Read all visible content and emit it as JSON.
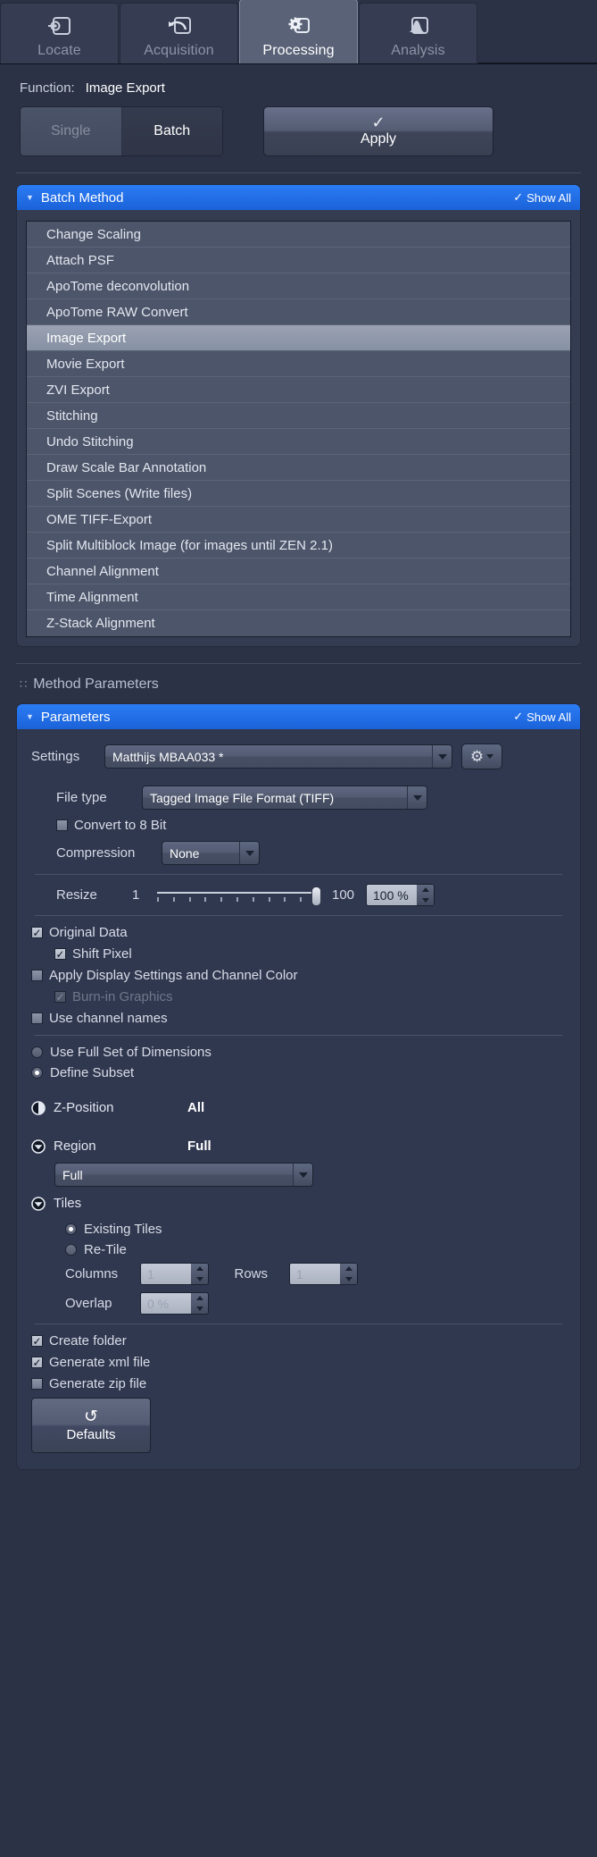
{
  "tabs": [
    {
      "label": "Locate",
      "icon": "locate-icon",
      "active": false
    },
    {
      "label": "Acquisition",
      "icon": "acquisition-icon",
      "active": false
    },
    {
      "label": "Processing",
      "icon": "processing-gear-icon",
      "active": true
    },
    {
      "label": "Analysis",
      "icon": "analysis-peak-icon",
      "active": false
    }
  ],
  "function": {
    "label": "Function:",
    "value": "Image Export"
  },
  "mode": {
    "single_label": "Single",
    "batch_label": "Batch",
    "selected": "Batch"
  },
  "apply": {
    "label": "Apply",
    "check_glyph": "✓"
  },
  "batch_method": {
    "header_title": "Batch Method",
    "show_all_label": "Show All",
    "show_all_glyph": "✓",
    "caret_glyph": "▼",
    "selected": "Image Export",
    "items": [
      "Change Scaling",
      "Attach PSF",
      "ApoTome deconvolution",
      "ApoTome RAW Convert",
      "Image Export",
      "Movie Export",
      "ZVI Export",
      "Stitching",
      "Undo Stitching",
      "Draw Scale Bar Annotation",
      "Split Scenes (Write files)",
      "OME TIFF-Export",
      "Split Multiblock Image (for images until ZEN 2.1)",
      "Channel Alignment",
      "Time Alignment",
      "Z-Stack Alignment"
    ]
  },
  "method_parameters": {
    "title": "Method Parameters",
    "grip_glyph": "∷"
  },
  "parameters": {
    "header_title": "Parameters",
    "show_all_label": "Show All",
    "show_all_glyph": "✓",
    "caret_glyph": "▼",
    "settings": {
      "label": "Settings",
      "value": "Matthijs MBAA033 *",
      "gear_glyph": "⚙"
    },
    "file_type": {
      "label": "File type",
      "value": "Tagged Image File Format (TIFF)"
    },
    "convert_8bit": {
      "label": "Convert to 8 Bit",
      "checked": false
    },
    "compression": {
      "label": "Compression",
      "value": "None"
    },
    "resize": {
      "label": "Resize",
      "min": "1",
      "max": "100",
      "value": "100 %",
      "percent": 100
    },
    "original_data": {
      "label": "Original Data",
      "checked": true
    },
    "shift_pixel": {
      "label": "Shift Pixel",
      "checked": true
    },
    "apply_display_settings": {
      "label": "Apply Display Settings and Channel Color",
      "checked": false
    },
    "burn_in_graphics": {
      "label": "Burn-in Graphics",
      "checked": true,
      "disabled": true
    },
    "use_channel_names": {
      "label": "Use channel names",
      "checked": false
    },
    "dimension_mode": {
      "full_set_label": "Use Full Set of Dimensions",
      "define_subset_label": "Define Subset",
      "selected": "Define Subset"
    },
    "z_position": {
      "label": "Z-Position",
      "value": "All"
    },
    "region": {
      "label": "Region",
      "value": "Full",
      "combo_value": "Full"
    },
    "tiles": {
      "label": "Tiles",
      "existing_tiles_label": "Existing Tiles",
      "retile_label": "Re-Tile",
      "selected": "Existing Tiles",
      "columns_label": "Columns",
      "columns_value": "1",
      "rows_label": "Rows",
      "rows_value": "1",
      "overlap_label": "Overlap",
      "overlap_value": "0 %"
    },
    "create_folder": {
      "label": "Create folder",
      "checked": true
    },
    "generate_xml": {
      "label": "Generate xml file",
      "checked": true
    },
    "generate_zip": {
      "label": "Generate zip file",
      "checked": false
    },
    "defaults": {
      "label": "Defaults",
      "icon_glyph": "↺"
    }
  },
  "colors": {
    "accent_blue": "#1f6fe8",
    "panel_bg": "#303850",
    "app_bg": "#2b3245",
    "list_bg": "#4c5569",
    "selection": "#9aa2b2"
  }
}
